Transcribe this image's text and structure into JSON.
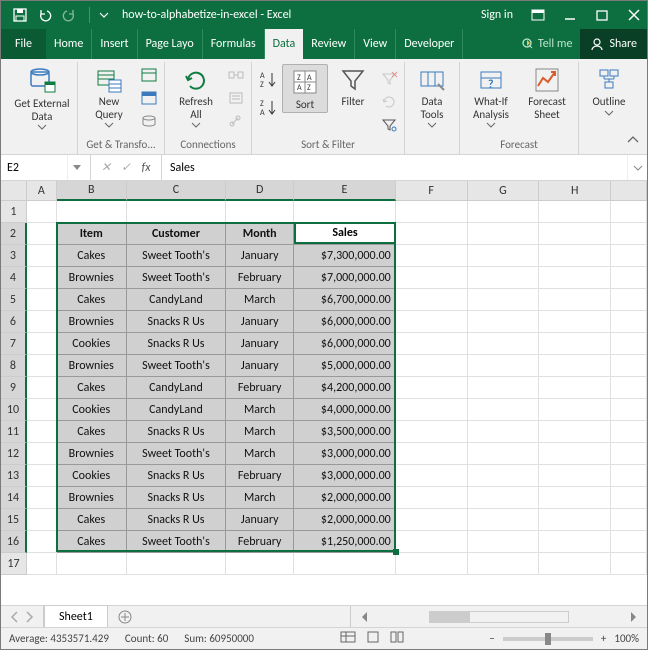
{
  "title": "how-to-alphabetize-in-excel - Excel",
  "sign_in": "Sign in",
  "file_tab": "File",
  "tabs": [
    "Home",
    "Insert",
    "Page Layo",
    "Formulas",
    "Data",
    "Review",
    "View",
    "Developer"
  ],
  "active_tab": "Data",
  "tell_me": "Tell me",
  "share": "Share",
  "ribbon": {
    "get_external": "Get External\nData",
    "new_query": "New\nQuery",
    "refresh_all": "Refresh\nAll",
    "sort": "Sort",
    "filter": "Filter",
    "data_tools": "Data\nTools",
    "what_if": "What-If\nAnalysis",
    "forecast_sheet": "Forecast\nSheet",
    "outline": "Outline",
    "grp_transform": "Get & Transfo...",
    "grp_connections": "Connections",
    "grp_sortfilter": "Sort & Filter",
    "grp_forecast": "Forecast"
  },
  "name_box": "E2",
  "formula": "Sales",
  "columns": [
    "A",
    "B",
    "C",
    "D",
    "E",
    "F",
    "G",
    "H"
  ],
  "data_headers": [
    "Item",
    "Customer",
    "Month",
    "Sales"
  ],
  "rows": [
    {
      "n": 2,
      "c": [
        "Item",
        "Customer",
        "Month",
        "Sales"
      ],
      "head": true
    },
    {
      "n": 3,
      "c": [
        "Cakes",
        "Sweet Tooth's",
        "January",
        "$7,300,000.00"
      ]
    },
    {
      "n": 4,
      "c": [
        "Brownies",
        "Sweet Tooth's",
        "February",
        "$7,000,000.00"
      ]
    },
    {
      "n": 5,
      "c": [
        "Cakes",
        "CandyLand",
        "March",
        "$6,700,000.00"
      ]
    },
    {
      "n": 6,
      "c": [
        "Brownies",
        "Snacks R Us",
        "January",
        "$6,000,000.00"
      ]
    },
    {
      "n": 7,
      "c": [
        "Cookies",
        "Snacks R Us",
        "January",
        "$6,000,000.00"
      ]
    },
    {
      "n": 8,
      "c": [
        "Brownies",
        "Sweet Tooth's",
        "January",
        "$5,000,000.00"
      ]
    },
    {
      "n": 9,
      "c": [
        "Cakes",
        "CandyLand",
        "February",
        "$4,200,000.00"
      ]
    },
    {
      "n": 10,
      "c": [
        "Cookies",
        "CandyLand",
        "March",
        "$4,000,000.00"
      ]
    },
    {
      "n": 11,
      "c": [
        "Cakes",
        "Snacks R Us",
        "March",
        "$3,500,000.00"
      ]
    },
    {
      "n": 12,
      "c": [
        "Brownies",
        "Sweet Tooth's",
        "March",
        "$3,000,000.00"
      ]
    },
    {
      "n": 13,
      "c": [
        "Cookies",
        "Snacks R Us",
        "February",
        "$3,000,000.00"
      ]
    },
    {
      "n": 14,
      "c": [
        "Brownies",
        "Snacks R Us",
        "March",
        "$2,000,000.00"
      ]
    },
    {
      "n": 15,
      "c": [
        "Cakes",
        "Snacks R Us",
        "January",
        "$2,000,000.00"
      ]
    },
    {
      "n": 16,
      "c": [
        "Cakes",
        "Sweet Tooth's",
        "February",
        "$1,250,000.00"
      ]
    }
  ],
  "sheet_tab": "Sheet1",
  "status": {
    "average": "Average: 4353571.429",
    "count": "Count: 60",
    "sum": "Sum: 60950000",
    "zoom": "100%"
  }
}
